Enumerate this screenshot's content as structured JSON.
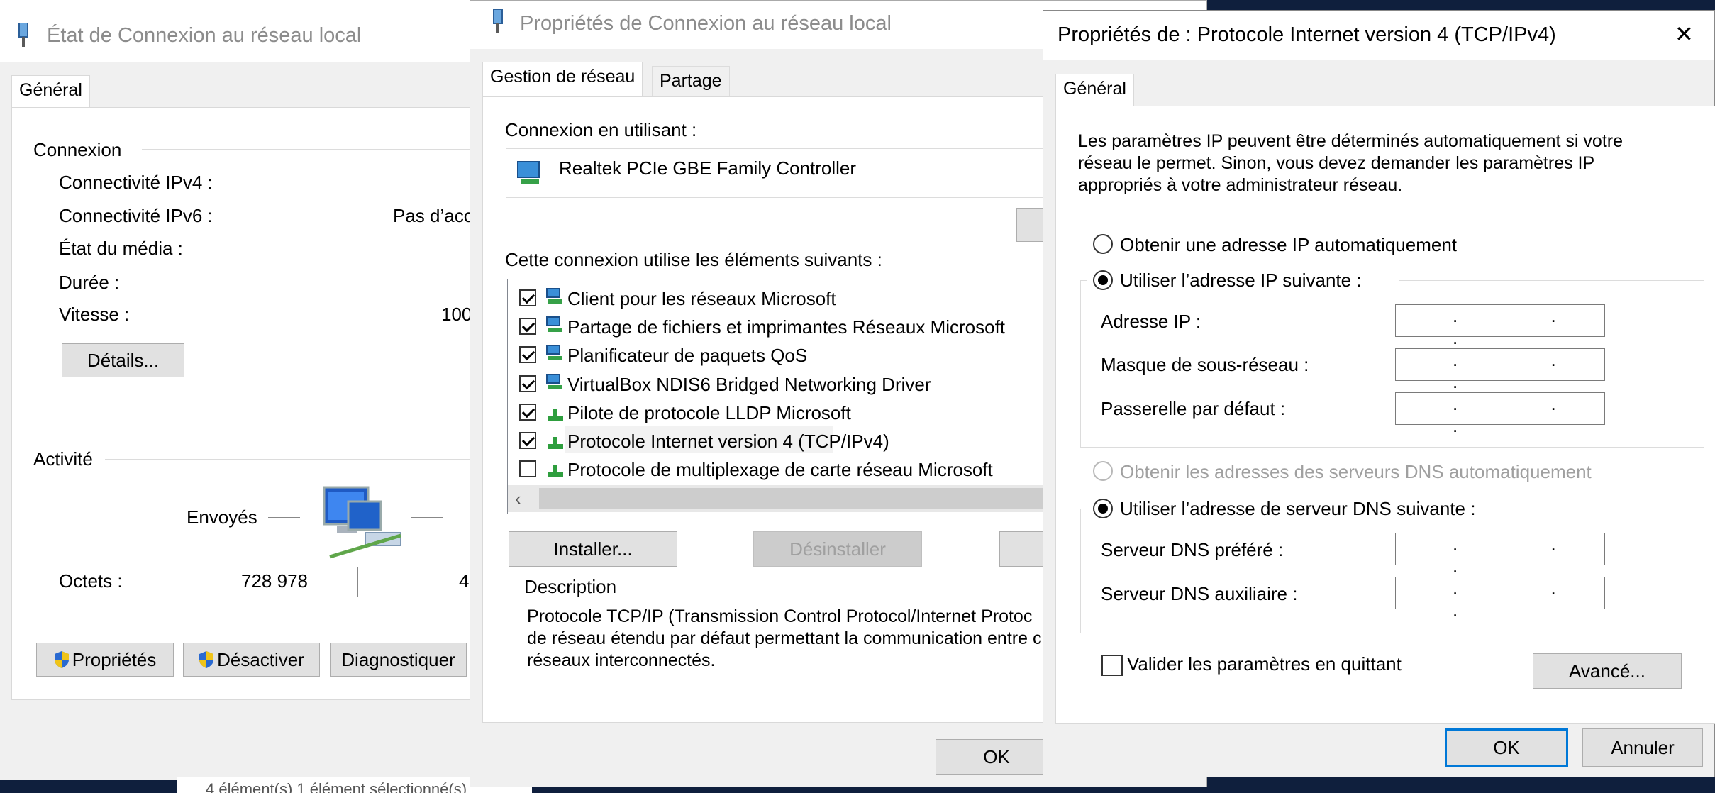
{
  "status_window": {
    "title": "État de Connexion au réseau local",
    "tab": "Général",
    "connexion_section": "Connexion",
    "rows": [
      {
        "label": "Connectivité IPv4 :",
        "value": ""
      },
      {
        "label": "Connectivité IPv6 :",
        "value": "Pas d’acc"
      },
      {
        "label": "État du média :",
        "value": ""
      },
      {
        "label": "Durée :",
        "value": ""
      },
      {
        "label": "Vitesse :",
        "value": "100"
      }
    ],
    "details_button": "Détails...",
    "activity_section": "Activité",
    "sent_label": "Envoyés",
    "bytes_label": "Octets :",
    "bytes_sent": "728 978",
    "bytes_received_partial": "4",
    "buttons": [
      "Propriétés",
      "Désactiver",
      "Diagnostiquer"
    ],
    "footer_partial": "4 élément(s)    1 élément sélectionné(s)"
  },
  "props_window": {
    "title": "Propriétés de Connexion au réseau local",
    "tabs": [
      "Gestion de réseau",
      "Partage"
    ],
    "connect_using_label": "Connexion en utilisant :",
    "adapter_name": "Realtek PCIe GBE Family Controller",
    "items_label": "Cette connexion utilise les éléments suivants :",
    "items": [
      {
        "label": "Client pour les réseaux Microsoft",
        "checked": true,
        "icon": "network-client-icon"
      },
      {
        "label": "Partage de fichiers et imprimantes Réseaux Microsoft",
        "checked": true,
        "icon": "network-service-icon"
      },
      {
        "label": "Planificateur de paquets QoS",
        "checked": true,
        "icon": "network-service-icon"
      },
      {
        "label": "VirtualBox NDIS6 Bridged Networking Driver",
        "checked": true,
        "icon": "network-service-icon"
      },
      {
        "label": "Pilote de protocole LLDP Microsoft",
        "checked": true,
        "icon": "protocol-icon"
      },
      {
        "label": "Protocole Internet version 4 (TCP/IPv4)",
        "checked": true,
        "icon": "protocol-icon"
      },
      {
        "label": "Protocole de multiplexage de carte réseau Microsoft",
        "checked": false,
        "icon": "protocol-icon"
      }
    ],
    "install_button": "Installer...",
    "uninstall_button": "Désinstaller",
    "description_label": "Description",
    "description_lines": [
      "Protocole TCP/IP (Transmission Control Protocol/Internet Protoc",
      "de réseau étendu par défaut permettant la communication entre c",
      "réseaux interconnectés."
    ],
    "ok_button": "OK"
  },
  "ipv4_window": {
    "title": "Propriétés de : Protocole Internet version 4 (TCP/IPv4)",
    "tab": "Général",
    "intro_lines": [
      "Les paramètres IP peuvent être déterminés automatiquement si votre",
      "réseau le permet. Sinon, vous devez demander les paramètres IP",
      "appropriés à votre administrateur réseau."
    ],
    "radio_auto_ip": "Obtenir une adresse IP automatiquement",
    "radio_manual_ip": "Utiliser l’adresse IP suivante :",
    "ip_fields": [
      {
        "label": "Adresse IP :",
        "value": ". . ."
      },
      {
        "label": "Masque de sous-réseau :",
        "value": ". . ."
      },
      {
        "label": "Passerelle par défaut :",
        "value": ". . ."
      }
    ],
    "radio_auto_dns": "Obtenir les adresses des serveurs DNS automatiquement",
    "radio_manual_dns": "Utiliser l’adresse de serveur DNS suivante :",
    "dns_fields": [
      {
        "label": "Serveur DNS préféré :",
        "value": ". . ."
      },
      {
        "label": "Serveur DNS auxiliaire :",
        "value": ". . ."
      }
    ],
    "validate_label": "Valider les paramètres en quittant",
    "advanced_button": "Avancé...",
    "ok_button": "OK",
    "cancel_button": "Annuler",
    "close_glyph": "✕"
  },
  "colors": {
    "accent": "#0078d7",
    "desktop": "#0f1f3d",
    "dialog_bg": "#f0f0f0"
  }
}
